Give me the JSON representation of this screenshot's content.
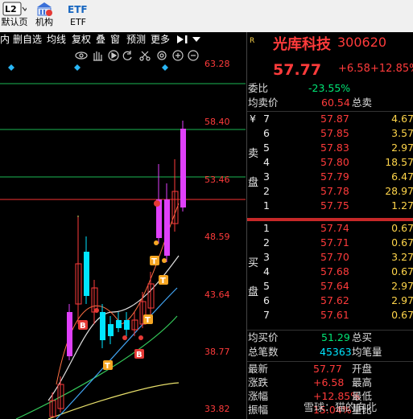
{
  "toolbar": {
    "items": [
      {
        "label": "默认页",
        "icon": "l2-icon",
        "badge": "L2"
      },
      {
        "label": "机构",
        "icon": "institution-icon"
      },
      {
        "label": "ETF",
        "icon": "etf-icon",
        "badge": "ETF"
      }
    ]
  },
  "chart_menu": [
    "内",
    "删自选",
    "均线",
    "复权",
    "叠",
    "窗",
    "预测",
    "更多"
  ],
  "price_axis": [
    "63.28",
    "58.40",
    "53.46",
    "48.59",
    "43.64",
    "38.77",
    "33.82"
  ],
  "markers": {
    "B": "B",
    "T": "T"
  },
  "stock": {
    "name": "光库科技",
    "code": "300620",
    "price": "57.77",
    "change": "+6.58",
    "change_pct": "+12.85%",
    "wei_bi_label": "委比",
    "wei_bi_value": "-23.55%",
    "avg_sell_label": "均卖价",
    "avg_sell_value": "60.54",
    "total_sell_label": "总卖",
    "sell_side_label": [
      "卖",
      "盘"
    ],
    "buy_side_label": [
      "买",
      "盘"
    ],
    "sell_orders": [
      {
        "level": "7",
        "price": "57.87",
        "vol": "4.67",
        "prefix": "¥"
      },
      {
        "level": "6",
        "price": "57.85",
        "vol": "3.57"
      },
      {
        "level": "5",
        "price": "57.83",
        "vol": "2.97"
      },
      {
        "level": "4",
        "price": "57.80",
        "vol": "18.57"
      },
      {
        "level": "3",
        "price": "57.79",
        "vol": "6.47"
      },
      {
        "level": "2",
        "price": "57.78",
        "vol": "28.97"
      },
      {
        "level": "1",
        "price": "57.75",
        "vol": "1.27"
      }
    ],
    "buy_orders": [
      {
        "level": "1",
        "price": "57.74",
        "vol": "0.67"
      },
      {
        "level": "2",
        "price": "57.71",
        "vol": "0.67"
      },
      {
        "level": "3",
        "price": "57.70",
        "vol": "3.27"
      },
      {
        "level": "4",
        "price": "57.68",
        "vol": "0.67"
      },
      {
        "level": "5",
        "price": "57.64",
        "vol": "2.97"
      },
      {
        "level": "6",
        "price": "57.62",
        "vol": "2.97"
      },
      {
        "level": "7",
        "price": "57.61",
        "vol": "0.67"
      }
    ],
    "avg_buy_label": "均买价",
    "avg_buy_value": "51.29",
    "total_buy_label": "总买",
    "total_vol_label": "总笔数",
    "total_vol_value": "45363",
    "avg_vol_label": "均笔量",
    "stats": [
      {
        "label": "最新",
        "value": "57.77",
        "label2": "开盘"
      },
      {
        "label": "涨跌",
        "value": "+6.58",
        "label2": "最高"
      },
      {
        "label": "涨幅",
        "value": "+12.85%",
        "label2": "最低"
      },
      {
        "label": "振幅",
        "value": "15.04%",
        "label2": "量比"
      }
    ]
  },
  "watermark": "雪球：猫的向北",
  "colors": {
    "up": "#ff3b3b",
    "down": "#00e5ff",
    "accent_magenta": "#e040fb",
    "line_green": "#00c853",
    "marker_orange": "#f5a623",
    "marker_red": "#e53935"
  }
}
